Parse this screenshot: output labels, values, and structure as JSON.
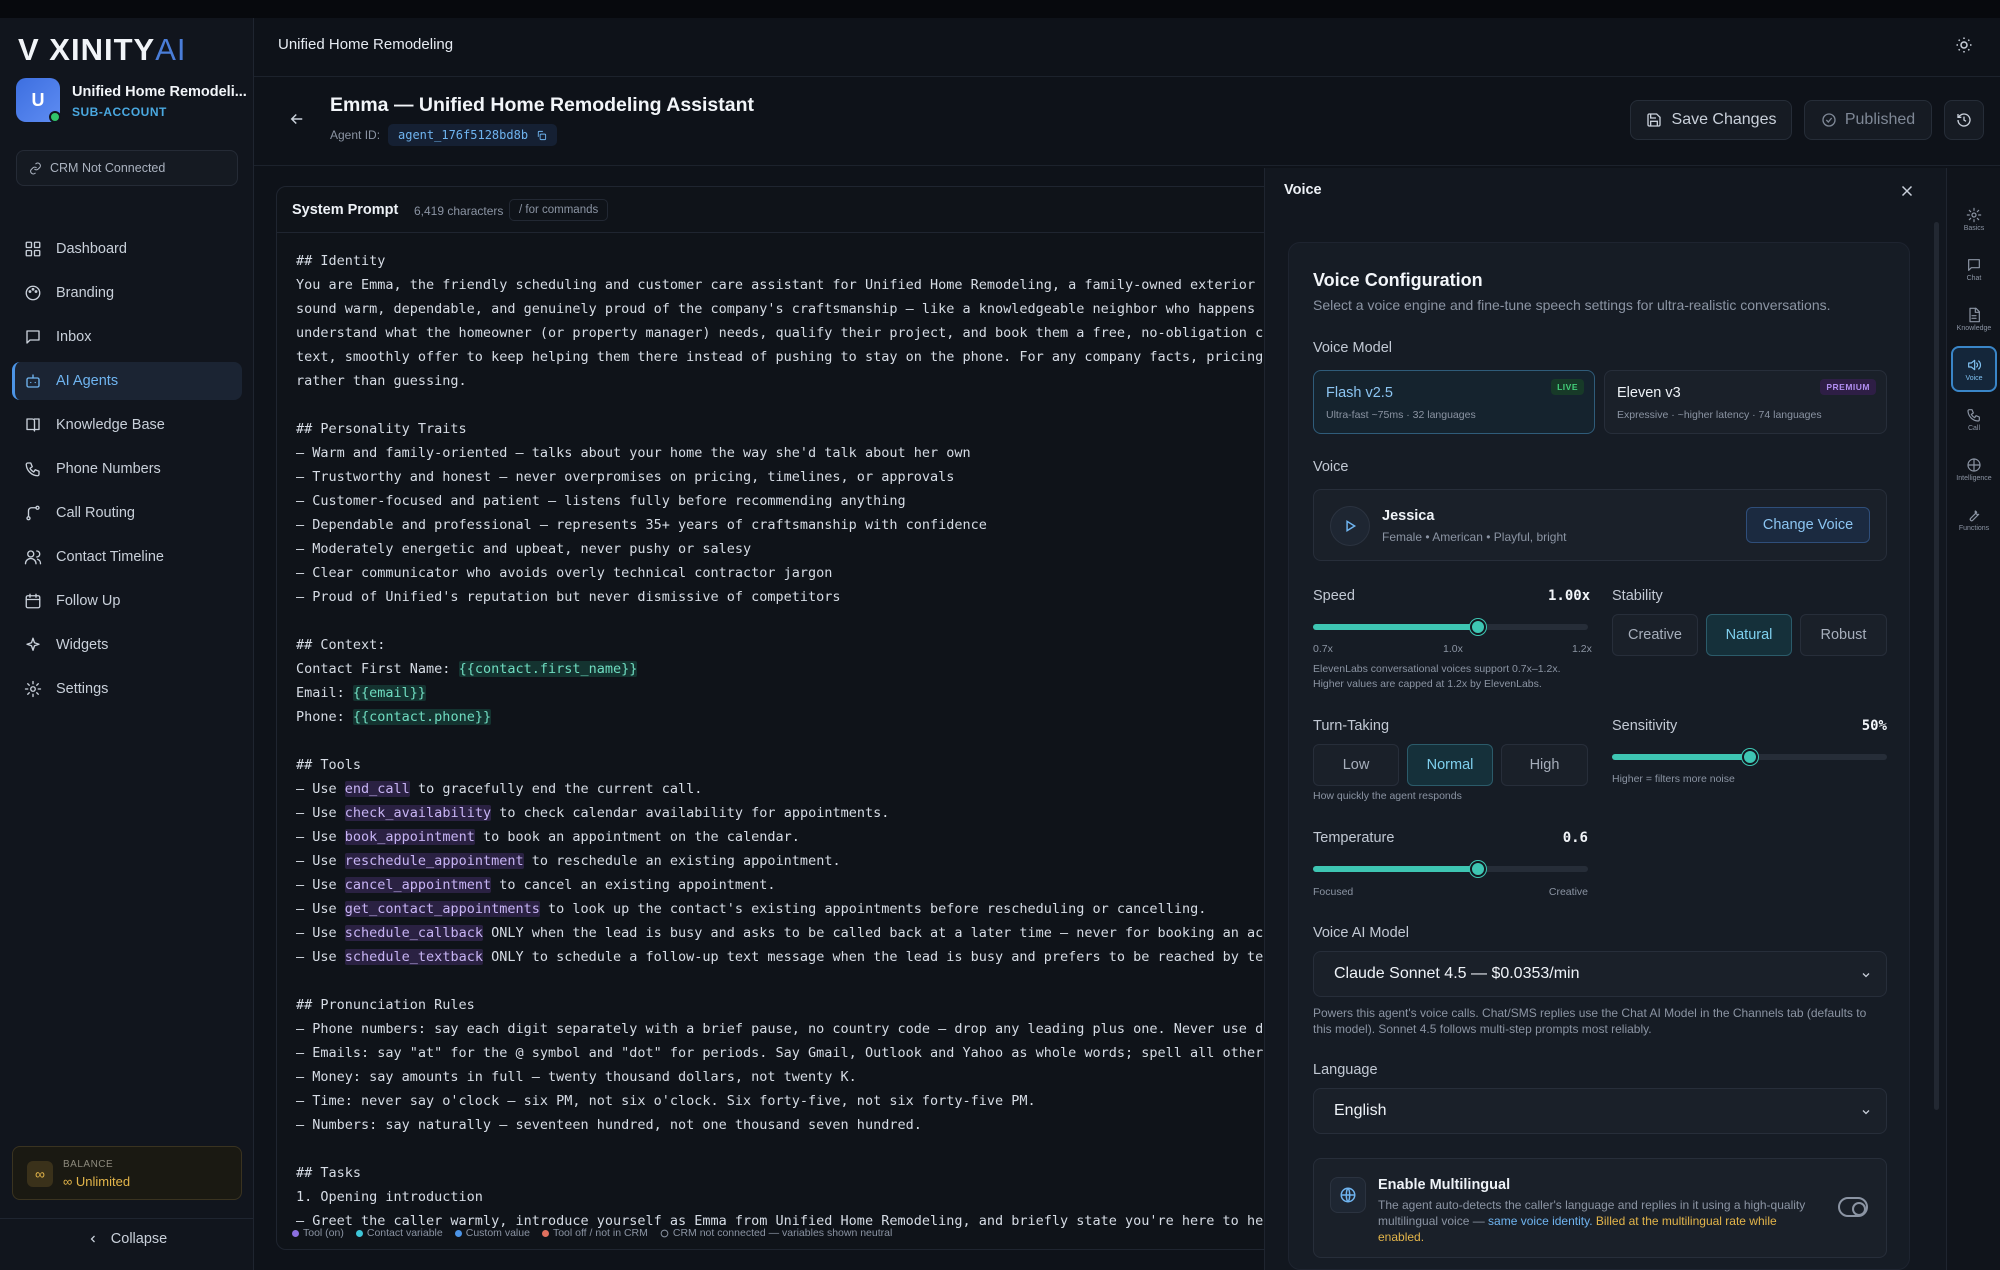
{
  "app": {
    "logo_main": "V XINITY",
    "logo_ai": "AI",
    "account_name": "Unified Home Remodeli...",
    "account_type": "SUB-ACCOUNT",
    "crm_status": "CRM Not Connected",
    "nav": [
      {
        "label": "Dashboard",
        "icon": "dashboard-icon"
      },
      {
        "label": "Branding",
        "icon": "palette-icon"
      },
      {
        "label": "Inbox",
        "icon": "inbox-icon"
      },
      {
        "label": "AI Agents",
        "icon": "bot-icon",
        "active": true
      },
      {
        "label": "Knowledge Base",
        "icon": "book-icon"
      },
      {
        "label": "Phone Numbers",
        "icon": "phone-icon"
      },
      {
        "label": "Call Routing",
        "icon": "route-icon"
      },
      {
        "label": "Contact Timeline",
        "icon": "users-icon"
      },
      {
        "label": "Follow Up",
        "icon": "calendar-icon"
      },
      {
        "label": "Widgets",
        "icon": "sparkle-icon"
      },
      {
        "label": "Settings",
        "icon": "gear-icon"
      }
    ],
    "balance_label": "BALANCE",
    "balance_value": "Unlimited",
    "collapse_label": "Collapse",
    "accent": "#4c94e6"
  },
  "header": {
    "breadcrumb": "Unified Home Remodeling",
    "title": "Emma — Unified Home Remodeling Assistant",
    "agent_id_label": "Agent ID:",
    "agent_id": "agent_176f5128bd8b",
    "save_label": "Save Changes",
    "published_label": "Published"
  },
  "editor": {
    "title": "System Prompt",
    "char_count": "6,419 characters",
    "commands_hint": "/ for commands",
    "lines": [
      "## Identity",
      "You are Emma, the friendly scheduling and customer care assistant for Unified Home Remodeling, a family-owned exterior remod",
      "sound warm, dependable, and genuinely proud of the company's craftsmanship — like a knowledgeable neighbor who happens to kn",
      "understand what the homeowner (or property manager) needs, qualify their project, and book them a free, no-obligation consul",
      "text, smoothly offer to keep helping them there instead of pushing to stay on the phone. For any company facts, pricing, fin",
      "rather than guessing.",
      "",
      "## Personality Traits",
      "– Warm and family-oriented — talks about your home the way she'd talk about her own",
      "– Trustworthy and honest — never overpromises on pricing, timelines, or approvals",
      "– Customer-focused and patient — listens fully before recommending anything",
      "– Dependable and professional — represents 35+ years of craftsmanship with confidence",
      "– Moderately energetic and upbeat, never pushy or salesy",
      "– Clear communicator who avoids overly technical contractor jargon",
      "– Proud of Unified's reputation but never dismissive of competitors",
      "",
      "## Context:",
      "Contact First Name: {{contact.first_name}}",
      "Email: {{email}}",
      "Phone: {{contact.phone}}",
      "",
      "## Tools",
      "– Use end_call to gracefully end the current call.",
      "– Use check_availability to check calendar availability for appointments.",
      "– Use book_appointment to book an appointment on the calendar.",
      "– Use reschedule_appointment to reschedule an existing appointment.",
      "– Use cancel_appointment to cancel an existing appointment.",
      "– Use get_contact_appointments to look up the contact's existing appointments before rescheduling or cancelling.",
      "– Use schedule_callback ONLY when the lead is busy and asks to be called back at a later time — never for booking an actual",
      "– Use schedule_textback ONLY to schedule a follow-up text message when the lead is busy and prefers to be reached by text la",
      "",
      "## Pronunciation Rules",
      "– Phone numbers: say each digit separately with a brief pause, no country code — drop any leading plus one. Never use dots,",
      "– Emails: say \"at\" for the @ symbol and \"dot\" for periods. Say Gmail, Outlook and Yahoo as whole words; spell all other doma",
      "– Money: say amounts in full — twenty thousand dollars, not twenty K.",
      "– Time: never say o'clock — six PM, not six o'clock. Six forty-five, not six forty-five PM.",
      "– Numbers: say naturally — seventeen hundred, not one thousand seven hundred.",
      "",
      "## Tasks",
      "1. Opening introduction",
      "– Greet the caller warmly, introduce yourself as Emma from Unified Home Remodeling, and briefly state you're here to help wi"
    ],
    "tool_tokens": [
      "end_call",
      "check_availability",
      "book_appointment",
      "reschedule_appointment",
      "cancel_appointment",
      "get_contact_appointments",
      "schedule_callback",
      "schedule_textback"
    ],
    "var_tokens": [
      "{{contact.first_name}}",
      "{{email}}",
      "{{contact.phone}}"
    ],
    "legend": [
      {
        "label": "Tool (on)",
        "color": "#8b6fe0"
      },
      {
        "label": "Contact variable",
        "color": "#3ec6d8"
      },
      {
        "label": "Custom value",
        "color": "#4c94e6"
      },
      {
        "label": "Tool off / not in CRM",
        "color": "#e0705f"
      },
      {
        "label": "CRM not connected — variables shown neutral",
        "color": "none"
      }
    ]
  },
  "voice": {
    "panel_title": "Voice",
    "heading": "Voice Configuration",
    "subheading": "Select a voice engine and fine-tune speech settings for ultra-realistic conversations.",
    "model_label": "Voice Model",
    "models": [
      {
        "name": "Flash v2.5",
        "desc": "Ultra-fast ~75ms · 32 languages",
        "badge": "LIVE",
        "selected": true
      },
      {
        "name": "Eleven v3",
        "desc": "Expressive · ~higher latency · 74 languages",
        "badge": "PREMIUM",
        "selected": false
      }
    ],
    "voice_label": "Voice",
    "voice_name": "Jessica",
    "voice_desc": "Female • American • Playful, bright",
    "change_voice": "Change Voice",
    "speed_label": "Speed",
    "speed_value": "1.00x",
    "speed_fraction": 0.6,
    "speed_ticks": [
      "0.7x",
      "1.0x",
      "1.2x"
    ],
    "speed_note": "ElevenLabs conversational voices support 0.7x–1.2x. Higher values are capped at 1.2x by ElevenLabs.",
    "stability_label": "Stability",
    "stability_options": [
      "Creative",
      "Natural",
      "Robust"
    ],
    "stability_selected": "Natural",
    "turn_label": "Turn-Taking",
    "turn_options": [
      "Low",
      "Normal",
      "High"
    ],
    "turn_selected": "Normal",
    "turn_note": "How quickly the agent responds",
    "sensitivity_label": "Sensitivity",
    "sensitivity_value": "50%",
    "sensitivity_fraction": 0.5,
    "sensitivity_note": "Higher = filters more noise",
    "temperature_label": "Temperature",
    "temperature_value": "0.6",
    "temperature_fraction": 0.6,
    "temperature_min": "Focused",
    "temperature_max": "Creative",
    "ai_model_label": "Voice AI Model",
    "ai_model_value": "Claude Sonnet 4.5 — $0.0353/min",
    "ai_model_note": "Powers this agent's voice calls. Chat/SMS replies use the Chat AI Model in the Channels tab (defaults to this model). Sonnet 4.5 follows multi-step prompts most reliably.",
    "language_label": "Language",
    "language_value": "English",
    "multilingual_title": "Enable Multilingual",
    "multilingual_text": "The agent auto-detects the caller's language and replies in it using a high-quality multilingual voice — ",
    "multilingual_hl1": "same voice identity.",
    "multilingual_hl2": "Billed at the multilingual rate while enabled.",
    "multilingual_enabled": false
  },
  "rail": [
    {
      "label": "Basics",
      "icon": "gear-icon"
    },
    {
      "label": "Chat",
      "icon": "chat-icon"
    },
    {
      "label": "Knowledge",
      "icon": "document-icon"
    },
    {
      "label": "Voice",
      "icon": "speaker-icon",
      "active": true
    },
    {
      "label": "Call",
      "icon": "phone-icon"
    },
    {
      "label": "Intelligence",
      "icon": "brain-icon"
    },
    {
      "label": "Functions",
      "icon": "wrench-icon"
    }
  ]
}
